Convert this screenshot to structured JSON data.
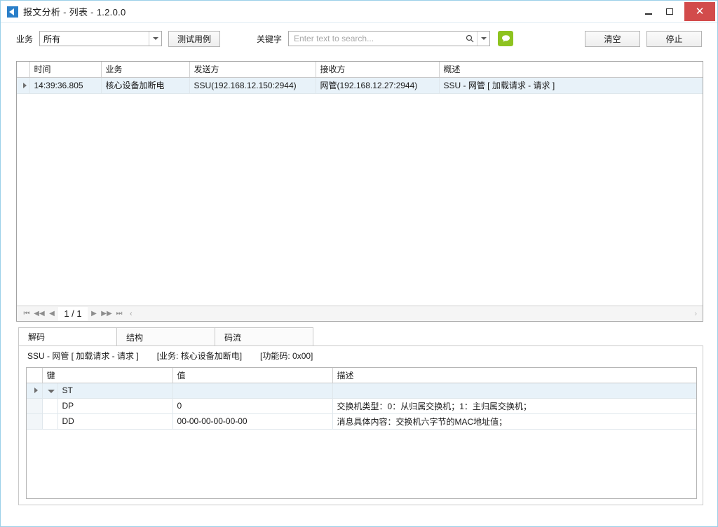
{
  "window": {
    "title": "报文分析 - 列表  -  1.2.0.0",
    "app_icon": "blue-play-icon",
    "controls": {
      "minimize": "minimize-icon",
      "maximize": "maximize-icon",
      "close": "✕"
    },
    "accent_border": "#9bd0e8",
    "close_color": "#d24b4b"
  },
  "toolbar": {
    "service_label": "业务",
    "service_value": "所有",
    "service_options": [
      "所有"
    ],
    "test_case_label": "测试用例",
    "keyword_label": "关键字",
    "search_placeholder": "Enter text to search...",
    "search_value": "",
    "search_icon": "magnifier-icon",
    "search_dropdown_icon": "chevron-down-icon",
    "green_button_icon": "speech-bubble-icon",
    "green_button_color": "#8ec320",
    "clear_label": "清空",
    "stop_label": "停止"
  },
  "grid": {
    "columns": [
      "时间",
      "业务",
      "发送方",
      "接收方",
      "概述"
    ],
    "rows": [
      {
        "indicator": "row-selected-arrow",
        "time": "14:39:36.805",
        "service": "核心设备加断电",
        "sender": "SSU(192.168.12.150:2944)",
        "receiver": "网管(192.168.12.27:2944)",
        "summary": "SSU - 网管 [ 加载请求 - 请求 ]"
      }
    ],
    "selected_row_color": "#e8f2f9"
  },
  "pager": {
    "first_icon": "⏮",
    "prev_page_icon": "◀◀",
    "prev_icon": "◀",
    "label": "1 / 1",
    "next_icon": "▶",
    "next_page_icon": "▶▶",
    "last_icon": "⏭",
    "collapse_icon": "‹",
    "right_chevron_icon": "›"
  },
  "tabs": [
    {
      "label": "解码",
      "active": true
    },
    {
      "label": "结构",
      "active": false
    },
    {
      "label": "码流",
      "active": false
    }
  ],
  "detail": {
    "header": {
      "title": "SSU - 网管 [ 加载请求 - 请求 ]",
      "service": "[业务: 核心设备加断电]",
      "function_code": "[功能码: 0x00]"
    },
    "columns": [
      "键",
      "值",
      "描述"
    ],
    "rows": [
      {
        "key": "ST",
        "value": "",
        "description": "",
        "group": true,
        "expander": "expander-collapse-icon",
        "indicator": "row-arrow"
      },
      {
        "key": "DP",
        "value": "0",
        "description": "交换机类型：0：从归属交换机；1：主归属交换机；",
        "group": false
      },
      {
        "key": "DD",
        "value": "00-00-00-00-00-00",
        "description": "消息具体内容：交换机六字节的MAC地址值；",
        "group": false
      }
    ]
  }
}
